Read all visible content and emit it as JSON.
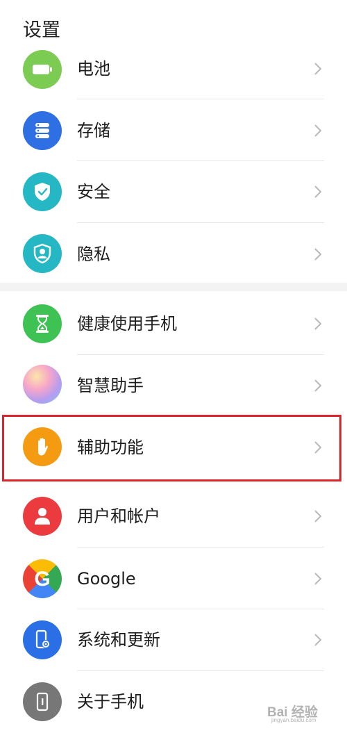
{
  "header": {
    "title": "设置"
  },
  "colors": {
    "battery": "#7ccb53",
    "storage": "#2f6fe4",
    "security": "#25b8c4",
    "privacy": "#25b8c4",
    "health": "#3fc254",
    "accessibility": "#f59b12",
    "users": "#ec3b3f",
    "system": "#2a6fe6",
    "about": "#777777",
    "highlight": "#d9252b"
  },
  "items": [
    {
      "label": "电池",
      "icon": "battery-icon"
    },
    {
      "label": "存储",
      "icon": "storage-icon"
    },
    {
      "label": "安全",
      "icon": "shield-check-icon"
    },
    {
      "label": "隐私",
      "icon": "privacy-shield-icon"
    },
    {
      "label": "健康使用手机",
      "icon": "hourglass-icon"
    },
    {
      "label": "智慧助手",
      "icon": "assistant-orb-icon"
    },
    {
      "label": "辅助功能",
      "icon": "hand-icon"
    },
    {
      "label": "用户和帐户",
      "icon": "user-icon"
    },
    {
      "label": "Google",
      "icon": "google-icon"
    },
    {
      "label": "系统和更新",
      "icon": "phone-gear-icon"
    },
    {
      "label": "关于手机",
      "icon": "phone-info-icon"
    }
  ],
  "watermark": {
    "text": "Bai 经验",
    "sub": "jingyan.baidu.com"
  }
}
